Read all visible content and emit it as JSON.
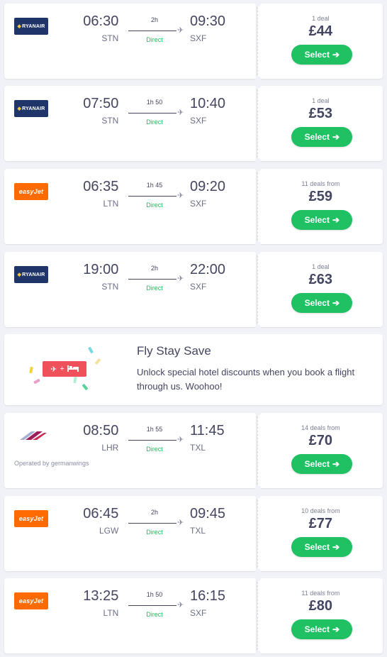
{
  "colors": {
    "accent_green": "#1fc163",
    "direct_green": "#1bbf5f",
    "ryanair_blue": "#1f3468",
    "ryanair_yellow": "#f2c641",
    "easyjet_orange": "#ff6b00",
    "promo_red": "#f0505a"
  },
  "flights": [
    {
      "airline": "RYANAIR",
      "logo_style": "ryanair",
      "dep_time": "06:30",
      "dep_code": "STN",
      "duration": "2h",
      "stops": "Direct",
      "arr_time": "09:30",
      "arr_code": "SXF",
      "deals": "1 deal",
      "price": "£44",
      "select_label": "Select",
      "operated_by": ""
    },
    {
      "airline": "RYANAIR",
      "logo_style": "ryanair",
      "dep_time": "07:50",
      "dep_code": "STN",
      "duration": "1h 50",
      "stops": "Direct",
      "arr_time": "10:40",
      "arr_code": "SXF",
      "deals": "1 deal",
      "price": "£53",
      "select_label": "Select",
      "operated_by": ""
    },
    {
      "airline": "easyJet",
      "logo_style": "easyjet",
      "dep_time": "06:35",
      "dep_code": "LTN",
      "duration": "1h 45",
      "stops": "Direct",
      "arr_time": "09:20",
      "arr_code": "SXF",
      "deals": "11 deals from",
      "price": "£59",
      "select_label": "Select",
      "operated_by": ""
    },
    {
      "airline": "RYANAIR",
      "logo_style": "ryanair",
      "dep_time": "19:00",
      "dep_code": "STN",
      "duration": "2h",
      "stops": "Direct",
      "arr_time": "22:00",
      "arr_code": "SXF",
      "deals": "1 deal",
      "price": "£63",
      "select_label": "Select",
      "operated_by": ""
    },
    {
      "airline": "",
      "logo_style": "eurowings",
      "dep_time": "08:50",
      "dep_code": "LHR",
      "duration": "1h 55",
      "stops": "Direct",
      "arr_time": "11:45",
      "arr_code": "TXL",
      "deals": "14 deals from",
      "price": "£70",
      "select_label": "Select",
      "operated_by": "Operated by germanwings"
    },
    {
      "airline": "easyJet",
      "logo_style": "easyjet",
      "dep_time": "06:45",
      "dep_code": "LGW",
      "duration": "2h",
      "stops": "Direct",
      "arr_time": "09:45",
      "arr_code": "TXL",
      "deals": "10 deals from",
      "price": "£77",
      "select_label": "Select",
      "operated_by": ""
    },
    {
      "airline": "easyJet",
      "logo_style": "easyjet",
      "dep_time": "13:25",
      "dep_code": "LTN",
      "duration": "1h 50",
      "stops": "Direct",
      "arr_time": "16:15",
      "arr_code": "SXF",
      "deals": "11 deals from",
      "price": "£80",
      "select_label": "Select",
      "operated_by": ""
    }
  ],
  "promo": {
    "title": "Fly Stay Save",
    "text": "Unlock special hotel discounts when you book a flight through us. Woohoo!",
    "badge_icons": [
      "plane-icon",
      "plus-icon",
      "bed-icon"
    ]
  }
}
